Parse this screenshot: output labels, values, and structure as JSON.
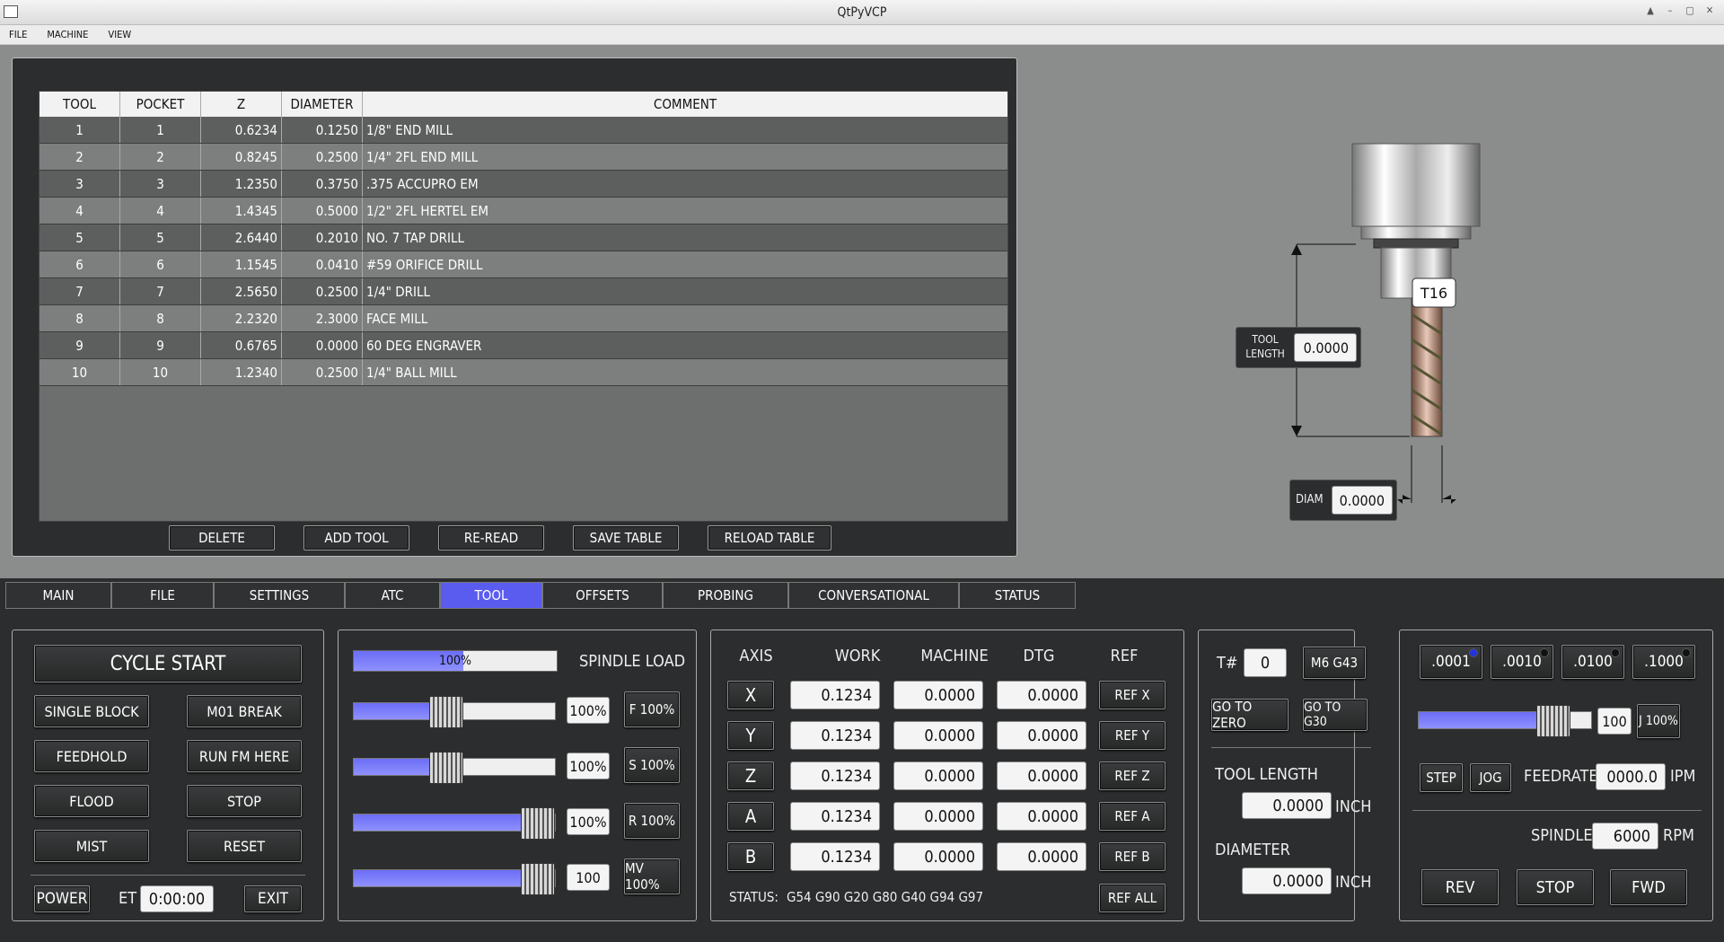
{
  "window": {
    "title": "QtPyVCP"
  },
  "menu": [
    "FILE",
    "MACHINE",
    "VIEW"
  ],
  "tool_table": {
    "headers": [
      "TOOL",
      "POCKET",
      "Z",
      "DIAMETER",
      "COMMENT"
    ],
    "rows": [
      [
        "1",
        "1",
        "0.6234",
        "0.1250",
        "1/8\" END MILL"
      ],
      [
        "2",
        "2",
        "0.8245",
        "0.2500",
        "1/4\" 2FL END MILL"
      ],
      [
        "3",
        "3",
        "1.2350",
        "0.3750",
        ".375 ACCUPRO EM"
      ],
      [
        "4",
        "4",
        "1.4345",
        "0.5000",
        "1/2\" 2FL HERTEL EM"
      ],
      [
        "5",
        "5",
        "2.6440",
        "0.2010",
        "NO. 7 TAP DRILL"
      ],
      [
        "6",
        "6",
        "1.1545",
        "0.0410",
        "#59 ORIFICE DRILL"
      ],
      [
        "7",
        "7",
        "2.5650",
        "0.2500",
        "1/4\" DRILL"
      ],
      [
        "8",
        "8",
        "2.2320",
        "2.3000",
        "FACE MILL"
      ],
      [
        "9",
        "9",
        "0.6765",
        "0.0000",
        "60 DEG ENGRAVER"
      ],
      [
        "10",
        "10",
        "1.2340",
        "0.2500",
        "1/4\" BALL MILL"
      ]
    ],
    "buttons": [
      "DELETE",
      "ADD TOOL",
      "RE-READ",
      "SAVE TABLE",
      "RELOAD TABLE"
    ]
  },
  "illustration": {
    "tool_label": "T16",
    "tool_length_label": "TOOL LENGTH",
    "tool_length_value": "0.0000",
    "diam_label": "DIAM",
    "diam_value": "0.0000"
  },
  "tabs": [
    "MAIN",
    "FILE",
    "SETTINGS",
    "ATC",
    "TOOL",
    "OFFSETS",
    "PROBING",
    "CONVERSATIONAL",
    "STATUS"
  ],
  "active_tab": "TOOL",
  "controls": {
    "cycle_start": "CYCLE START",
    "single_block": "SINGLE BLOCK",
    "m01_break": "M01 BREAK",
    "feedhold": "FEEDHOLD",
    "run_fm_here": "RUN FM HERE",
    "flood": "FLOOD",
    "stop": "STOP",
    "mist": "MIST",
    "reset": "RESET",
    "power": "POWER",
    "et_label": "ET",
    "et_value": "0:00:00",
    "exit": "EXIT"
  },
  "overrides": {
    "spindle_load_label": "SPINDLE LOAD",
    "spindle_load_pct": "100%",
    "spindle_load": 1.0,
    "rows": [
      {
        "value": "100%",
        "button": "F 100%",
        "level": 0.45
      },
      {
        "value": "100%",
        "button": "S 100%",
        "level": 0.45
      },
      {
        "value": "100%",
        "button": "R 100%",
        "level": 1.0
      },
      {
        "value": "100",
        "button": "MV 100%",
        "level": 1.0
      }
    ]
  },
  "dro": {
    "headers": [
      "AXIS",
      "WORK",
      "MACHINE",
      "DTG",
      "REF"
    ],
    "axes": [
      {
        "axis": "X",
        "work": "0.1234",
        "machine": "0.0000",
        "dtg": "0.0000",
        "ref": "REF X"
      },
      {
        "axis": "Y",
        "work": "0.1234",
        "machine": "0.0000",
        "dtg": "0.0000",
        "ref": "REF Y"
      },
      {
        "axis": "Z",
        "work": "0.1234",
        "machine": "0.0000",
        "dtg": "0.0000",
        "ref": "REF Z"
      },
      {
        "axis": "A",
        "work": "0.1234",
        "machine": "0.0000",
        "dtg": "0.0000",
        "ref": "REF A"
      },
      {
        "axis": "B",
        "work": "0.1234",
        "machine": "0.0000",
        "dtg": "0.0000",
        "ref": "REF B"
      }
    ],
    "status_label": "STATUS:",
    "status_codes": "G54  G90  G20  G80  G40  G94  G97",
    "ref_all": "REF ALL"
  },
  "toolpanel": {
    "t_label": "T#",
    "t_value": "0",
    "m6g43": "M6 G43",
    "go_zero": "GO TO ZERO",
    "go_g30": "GO TO G30",
    "tool_length_label": "TOOL LENGTH",
    "tool_length_value": "0.0000",
    "diameter_label": "DIAMETER",
    "diameter_value": "0.0000",
    "unit": "INCH"
  },
  "jog": {
    "increments": [
      ".0001",
      ".0010",
      ".0100",
      ".1000"
    ],
    "active_increment": ".0001",
    "rate_value": "100",
    "rate_level": 0.85,
    "j100": "J 100%",
    "step": "STEP",
    "jog": "JOG",
    "feedrate_label": "FEEDRATE",
    "feedrate_value": "0000.0",
    "feedrate_unit": "IPM",
    "spindle_label": "SPINDLE",
    "spindle_value": "6000",
    "spindle_unit": "RPM",
    "rev": "REV",
    "stop": "STOP",
    "fwd": "FWD"
  }
}
